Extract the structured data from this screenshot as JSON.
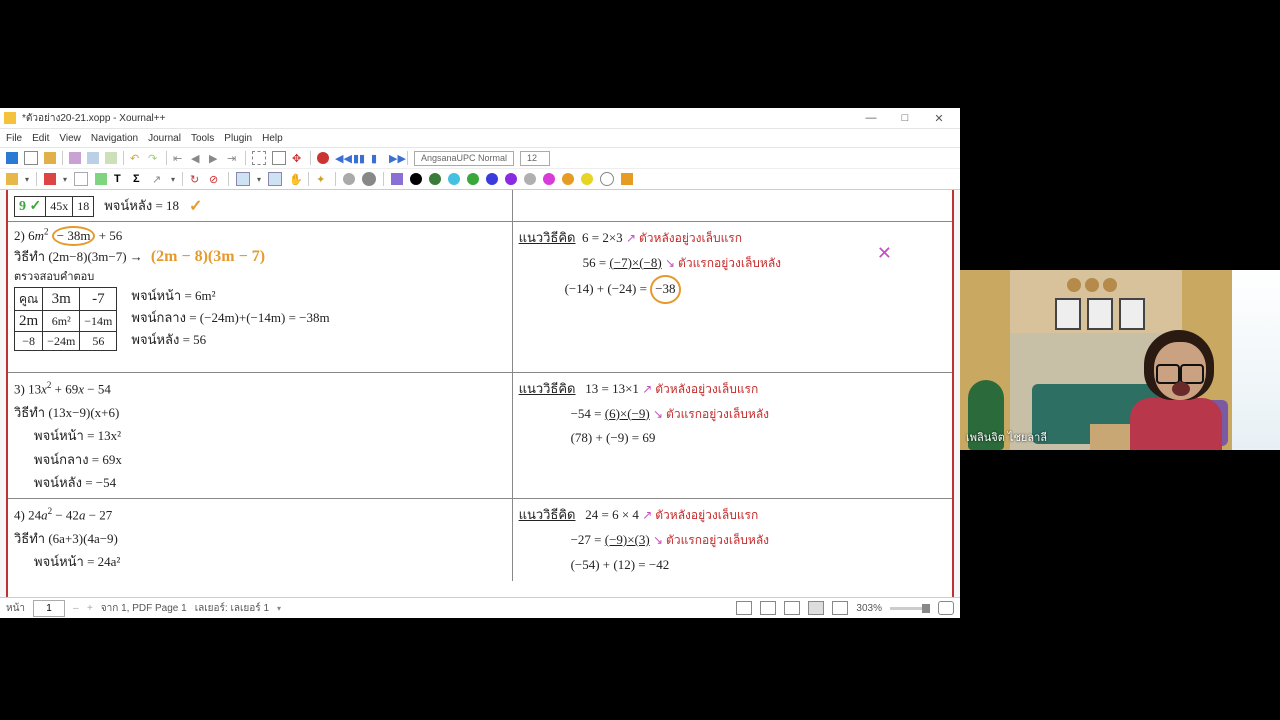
{
  "window": {
    "title": "*ตัวอย่าง20-21.xopp - Xournal++",
    "minimize": "—",
    "maximize": "□",
    "close": "✕"
  },
  "menu": [
    "File",
    "Edit",
    "View",
    "Navigation",
    "Journal",
    "Tools",
    "Plugin",
    "Help"
  ],
  "toolbar": {
    "font_name": "AngsanaUPC Normal",
    "font_size": "12"
  },
  "colors": [
    "#000000",
    "#3a7a3a",
    "#44c0e0",
    "#3aa73a",
    "#3b3bdc",
    "#8a2be2",
    "#b0b0b0",
    "#d83cd8",
    "#e69b24",
    "#e6d524",
    "#ffffff",
    "#e69b24"
  ],
  "doc": {
    "row0": {
      "cells": [
        "9 ✓",
        "45x",
        "18"
      ],
      "rear_label": "พจน์หลัง = 18",
      "check": "✓"
    },
    "row1": {
      "prob": "2) 6m² − 38m + 56",
      "line_factor": "วิธีทำ (2m−8)(3m−7) →",
      "hand": "(2m − 8)(3m − 7)",
      "check_label": "ตรวจสอบคำตอบ",
      "table": [
        [
          "คูณ",
          "3m",
          "-7"
        ],
        [
          "2m",
          "6m²",
          "−14m"
        ],
        [
          "−8",
          "−24m",
          "56"
        ]
      ],
      "front": "พจน์หน้า = 6m²",
      "mid": "พจน์กลาง = (−24m)+(−14m) = −38m",
      "rear": "พจน์หลัง = 56",
      "hint_title": "แนววิธีคิด",
      "hint1": "6 = 2×3",
      "hint2": "56 = (−7)×(−8)",
      "hint3": "(−14) + (−24) = −38",
      "note1": "ตัวหลังอยู่วงเล็บแรก",
      "note2": "ตัวแรกอยู่วงเล็บหลัง",
      "circled": "−38"
    },
    "row2": {
      "prob": "3) 13x² + 69x − 54",
      "factor": "วิธีทำ (13x−9)(x+6)",
      "front": "พจน์หน้า =  13x²",
      "mid": "พจน์กลาง  = 69x",
      "rear": "พจน์หลัง = −54",
      "hint_title": "แนววิธีคิด",
      "hint1": "13 = 13×1",
      "hint2": "−54 = (6)×(−9)",
      "hint3": "(78) + (−9) = 69",
      "note1": "ตัวหลังอยู่วงเล็บแรก",
      "note2": "ตัวแรกอยู่วงเล็บหลัง"
    },
    "row3": {
      "prob": "4) 24a² − 42a − 27",
      "factor": "วิธีทำ (6a+3)(4a−9)",
      "front": "พจน์หน้า =  24a²",
      "hint_title": "แนววิธีคิด",
      "hint1": "24  =  6 × 4",
      "hint2": "−27 = (−9)×(3)",
      "hint3": "(−54) + (12) = −42",
      "note1": "ตัวหลังอยู่วงเล็บแรก",
      "note2": "ตัวแรกอยู่วงเล็บหลัง"
    }
  },
  "status": {
    "page_label": "หน้า",
    "page_value": "1",
    "page_of": "จาก 1, PDF Page 1",
    "layer": "เลเยอร์: เลเยอร์ 1",
    "zoom": "303%"
  },
  "webcam": {
    "name": "เพลินจิต ไชยลาลี"
  }
}
